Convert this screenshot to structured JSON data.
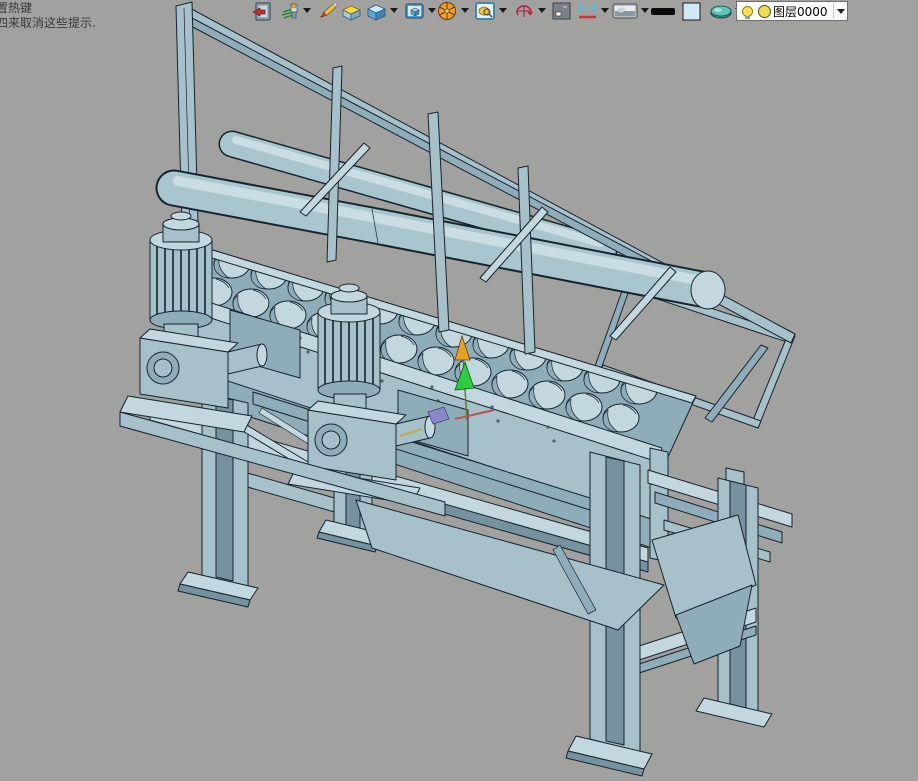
{
  "app": {
    "background_color": "#a1a19f",
    "outline_color": "#16242e",
    "steel_light": "#c2d8de",
    "steel_mid": "#a6c1c9",
    "steel_dark": "#8fadb8"
  },
  "hints": {
    "line1": "置热键",
    "line2": "四来取消这些提示."
  },
  "toolbar": {
    "icons": [
      {
        "name": "open-document-icon",
        "dropdown": false
      },
      {
        "name": "plant-feature-icon",
        "dropdown": true
      },
      {
        "name": "pencil-sketch-icon",
        "dropdown": false
      },
      {
        "name": "yellow-lid-box-icon",
        "dropdown": false
      },
      {
        "name": "solid-cube-icon",
        "dropdown": true
      },
      {
        "name": "cube-view-icon",
        "dropdown": true
      },
      {
        "name": "orange-wheel-icon",
        "dropdown": true
      },
      {
        "name": "zoom-window-icon",
        "dropdown": true
      },
      {
        "name": "orbit-rotate-icon",
        "dropdown": true
      },
      {
        "name": "pan-view-icon",
        "dropdown": false
      },
      {
        "name": "dimension-icon",
        "dropdown": true
      },
      {
        "name": "display-monitor-icon",
        "dropdown": true
      },
      {
        "name": "line-weight-swatch",
        "dropdown": false
      },
      {
        "name": "background-color-swatch",
        "dropdown": false
      },
      {
        "name": "ucs-plane-icon",
        "dropdown": true
      }
    ]
  },
  "layer_combo": {
    "value": "图层0000",
    "bulb_color": "#ffe24a",
    "layer_color": "#f0df4e"
  },
  "viewport": {
    "model": "dual-shaft screw conveyor with guard railing",
    "axis_colors": {
      "up": "#2ecc40",
      "secondary": "#e8a020",
      "x": "#c05050",
      "origin": "#8888cc"
    }
  }
}
